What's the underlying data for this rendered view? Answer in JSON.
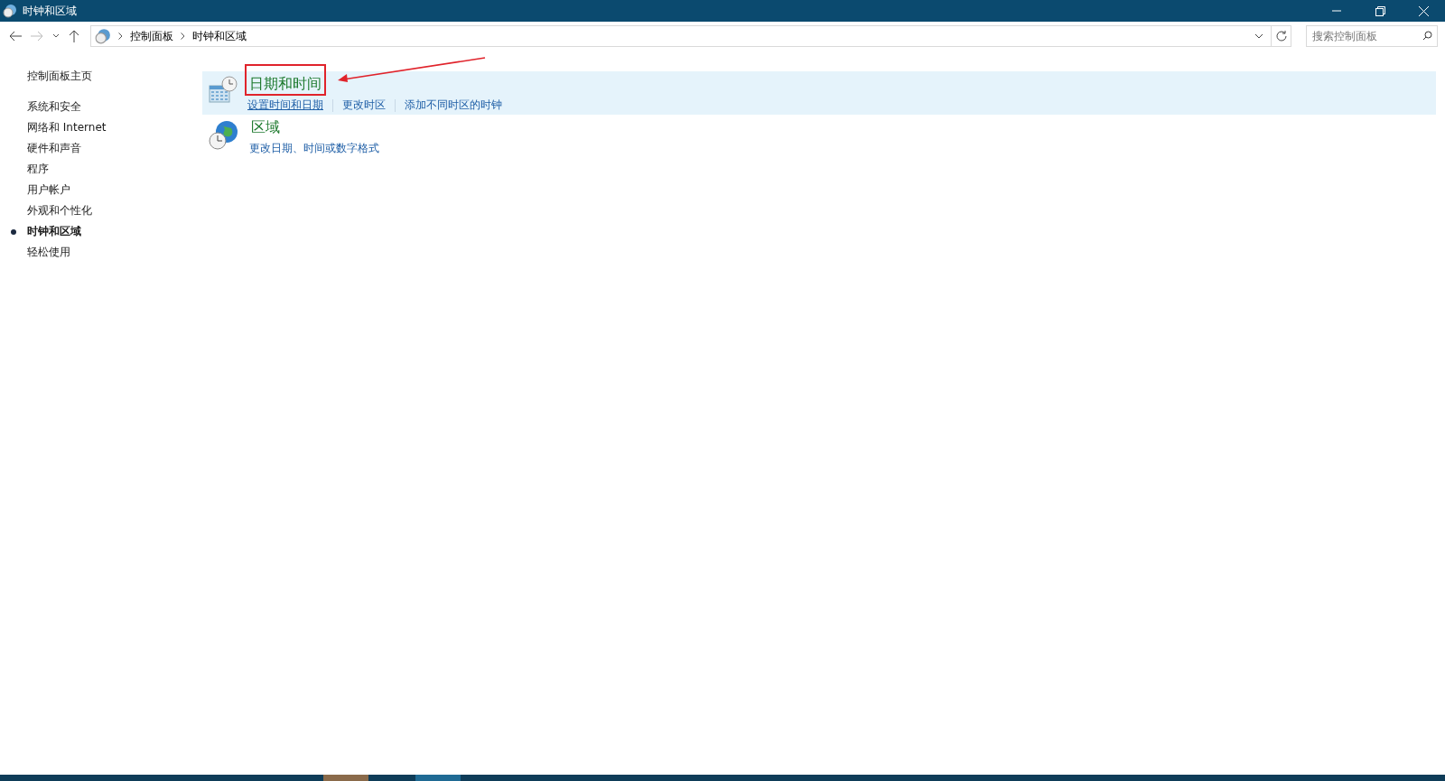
{
  "window": {
    "title": "时钟和区域"
  },
  "address_bar": {
    "breadcrumbs": [
      "控制面板",
      "时钟和区域"
    ]
  },
  "search": {
    "placeholder": "搜索控制面板"
  },
  "sidebar": {
    "home": "控制面板主页",
    "items": [
      {
        "label": "系统和安全",
        "selected": false
      },
      {
        "label": "网络和 Internet",
        "selected": false
      },
      {
        "label": "硬件和声音",
        "selected": false
      },
      {
        "label": "程序",
        "selected": false
      },
      {
        "label": "用户帐户",
        "selected": false
      },
      {
        "label": "外观和个性化",
        "selected": false
      },
      {
        "label": "时钟和区域",
        "selected": true
      },
      {
        "label": "轻松使用",
        "selected": false
      }
    ]
  },
  "categories": [
    {
      "kind": "datetime",
      "title": "日期和时间",
      "hovered": true,
      "annotated": true,
      "links": [
        {
          "label": "设置时间和日期",
          "hovered": true
        },
        {
          "label": "更改时区",
          "hovered": false
        },
        {
          "label": "添加不同时区的时钟",
          "hovered": false
        }
      ]
    },
    {
      "kind": "region",
      "title": "区域",
      "hovered": false,
      "annotated": false,
      "links": [
        {
          "label": "更改日期、时间或数字格式",
          "hovered": false
        }
      ]
    }
  ]
}
